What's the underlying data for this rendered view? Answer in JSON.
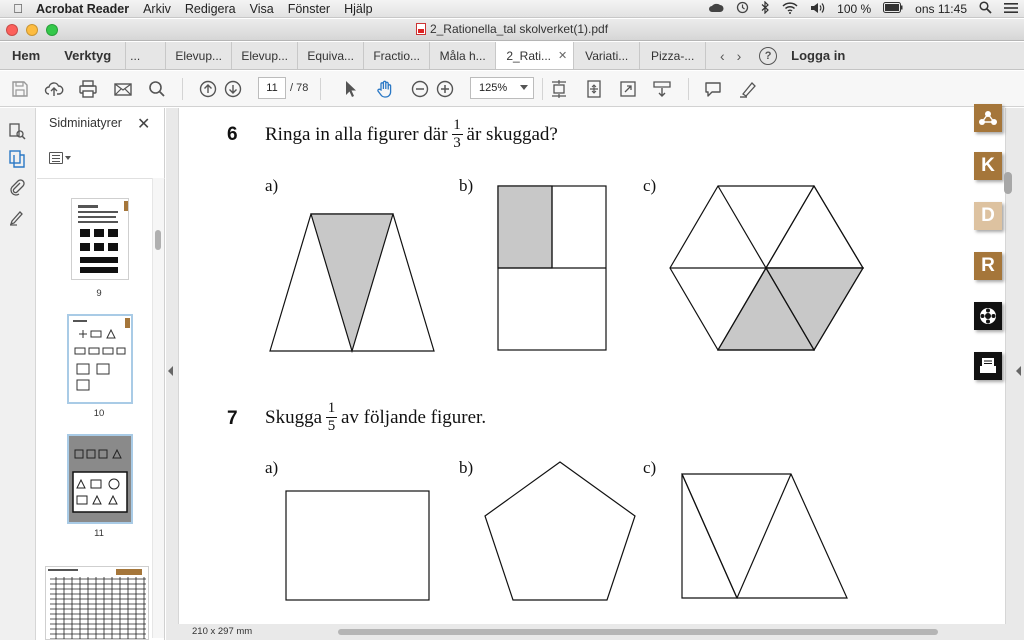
{
  "menubar": {
    "app_name": "Acrobat Reader",
    "items": [
      "Arkiv",
      "Redigera",
      "Visa",
      "Fönster",
      "Hjälp"
    ],
    "battery": "100 %",
    "clock": "ons 11:45"
  },
  "window": {
    "title": "2_Rationella_tal skolverket(1).pdf"
  },
  "tabs": {
    "home": "Hem",
    "tools": "Verktyg",
    "documents": [
      "...",
      "Elevup...",
      "Elevup...",
      "Equiva...",
      "Fractio...",
      "Måla h...",
      "2_Rati...",
      "Variati...",
      "Pizza-..."
    ],
    "active_index": 6,
    "login": "Logga in",
    "help": "?"
  },
  "toolbar": {
    "page_current": "11",
    "page_total": "/ 78",
    "zoom": "125%"
  },
  "thumbnails": {
    "title": "Sidminiatyrer",
    "pages": [
      {
        "number": "9",
        "selected": false
      },
      {
        "number": "10",
        "selected": false
      },
      {
        "number": "11",
        "selected": true
      },
      {
        "number": "",
        "selected": false
      }
    ]
  },
  "document": {
    "q6": {
      "number": "6",
      "text_before": "Ringa in alla figurer där",
      "frac_num": "1",
      "frac_den": "3",
      "text_after": "är skuggad?",
      "labels": [
        "a)",
        "b)",
        "c)"
      ]
    },
    "q7": {
      "number": "7",
      "text_before": "Skugga",
      "frac_num": "1",
      "frac_den": "5",
      "text_after": "av följande figurer.",
      "labels": [
        "a)",
        "b)",
        "c)"
      ]
    },
    "shade_color": "#c8c8c8"
  },
  "right_tools": [
    "K",
    "D",
    "R"
  ],
  "status": {
    "page_size": "210 x 297 mm"
  }
}
